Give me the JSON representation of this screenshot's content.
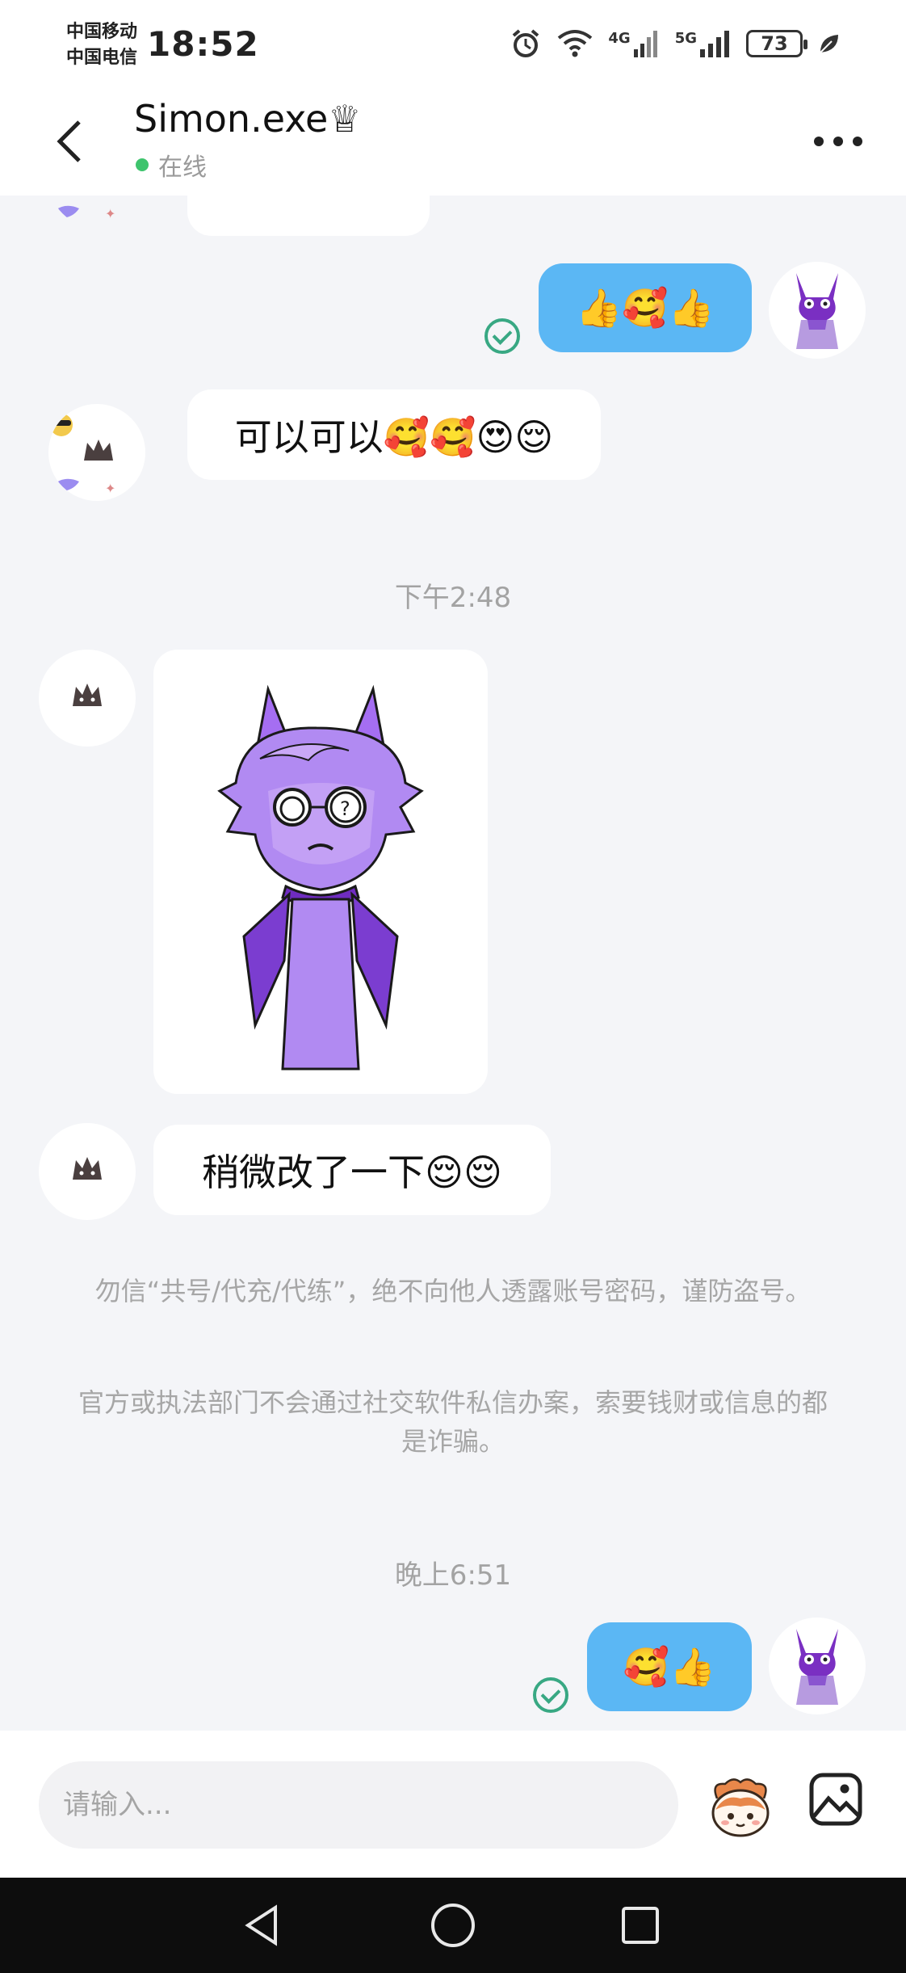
{
  "status_bar": {
    "carrier_1": "中国移动",
    "carrier_2": "中国电信",
    "time": "18:52",
    "network_1": "4G",
    "network_2": "5G",
    "battery": "73",
    "icons": [
      "alarm-icon",
      "wifi-icon",
      "signal-icon",
      "leaf-icon"
    ]
  },
  "header": {
    "name": "Simon.exe♕",
    "status": "在线",
    "online_color": "#3ec46d"
  },
  "messages": [
    {
      "direction": "out",
      "text": "👍🥰👍",
      "status": "read"
    },
    {
      "direction": "in",
      "text": "可以可以🥰🥰😍😌"
    },
    {
      "type": "timestamp",
      "text": "下午2:48"
    },
    {
      "direction": "in",
      "type": "sticker",
      "sticker": "purple-horned-character-with-glasses"
    },
    {
      "direction": "in",
      "text": "稍微改了一下😌😌"
    },
    {
      "type": "notice",
      "paragraphs": [
        "勿信“共号/代充/代练”，绝不向他人透露账号密码，谨防盗号。",
        "官方或执法部门不会通过社交软件私信办案，索要钱财或信息的都是诈骗。"
      ]
    },
    {
      "type": "timestamp",
      "text": "晚上6:51"
    },
    {
      "direction": "out",
      "text": "🥰👍",
      "status": "read"
    }
  ],
  "composer": {
    "placeholder": "请输入...",
    "sticker_button": "sticker-icon",
    "image_button": "image-icon"
  },
  "nav": {
    "buttons": [
      "back-triangle",
      "home-circle",
      "recents-square"
    ]
  },
  "colors": {
    "outgoing_bubble": "#5bb7f4",
    "read_check": "#38a883",
    "background": "#f4f5f8"
  }
}
